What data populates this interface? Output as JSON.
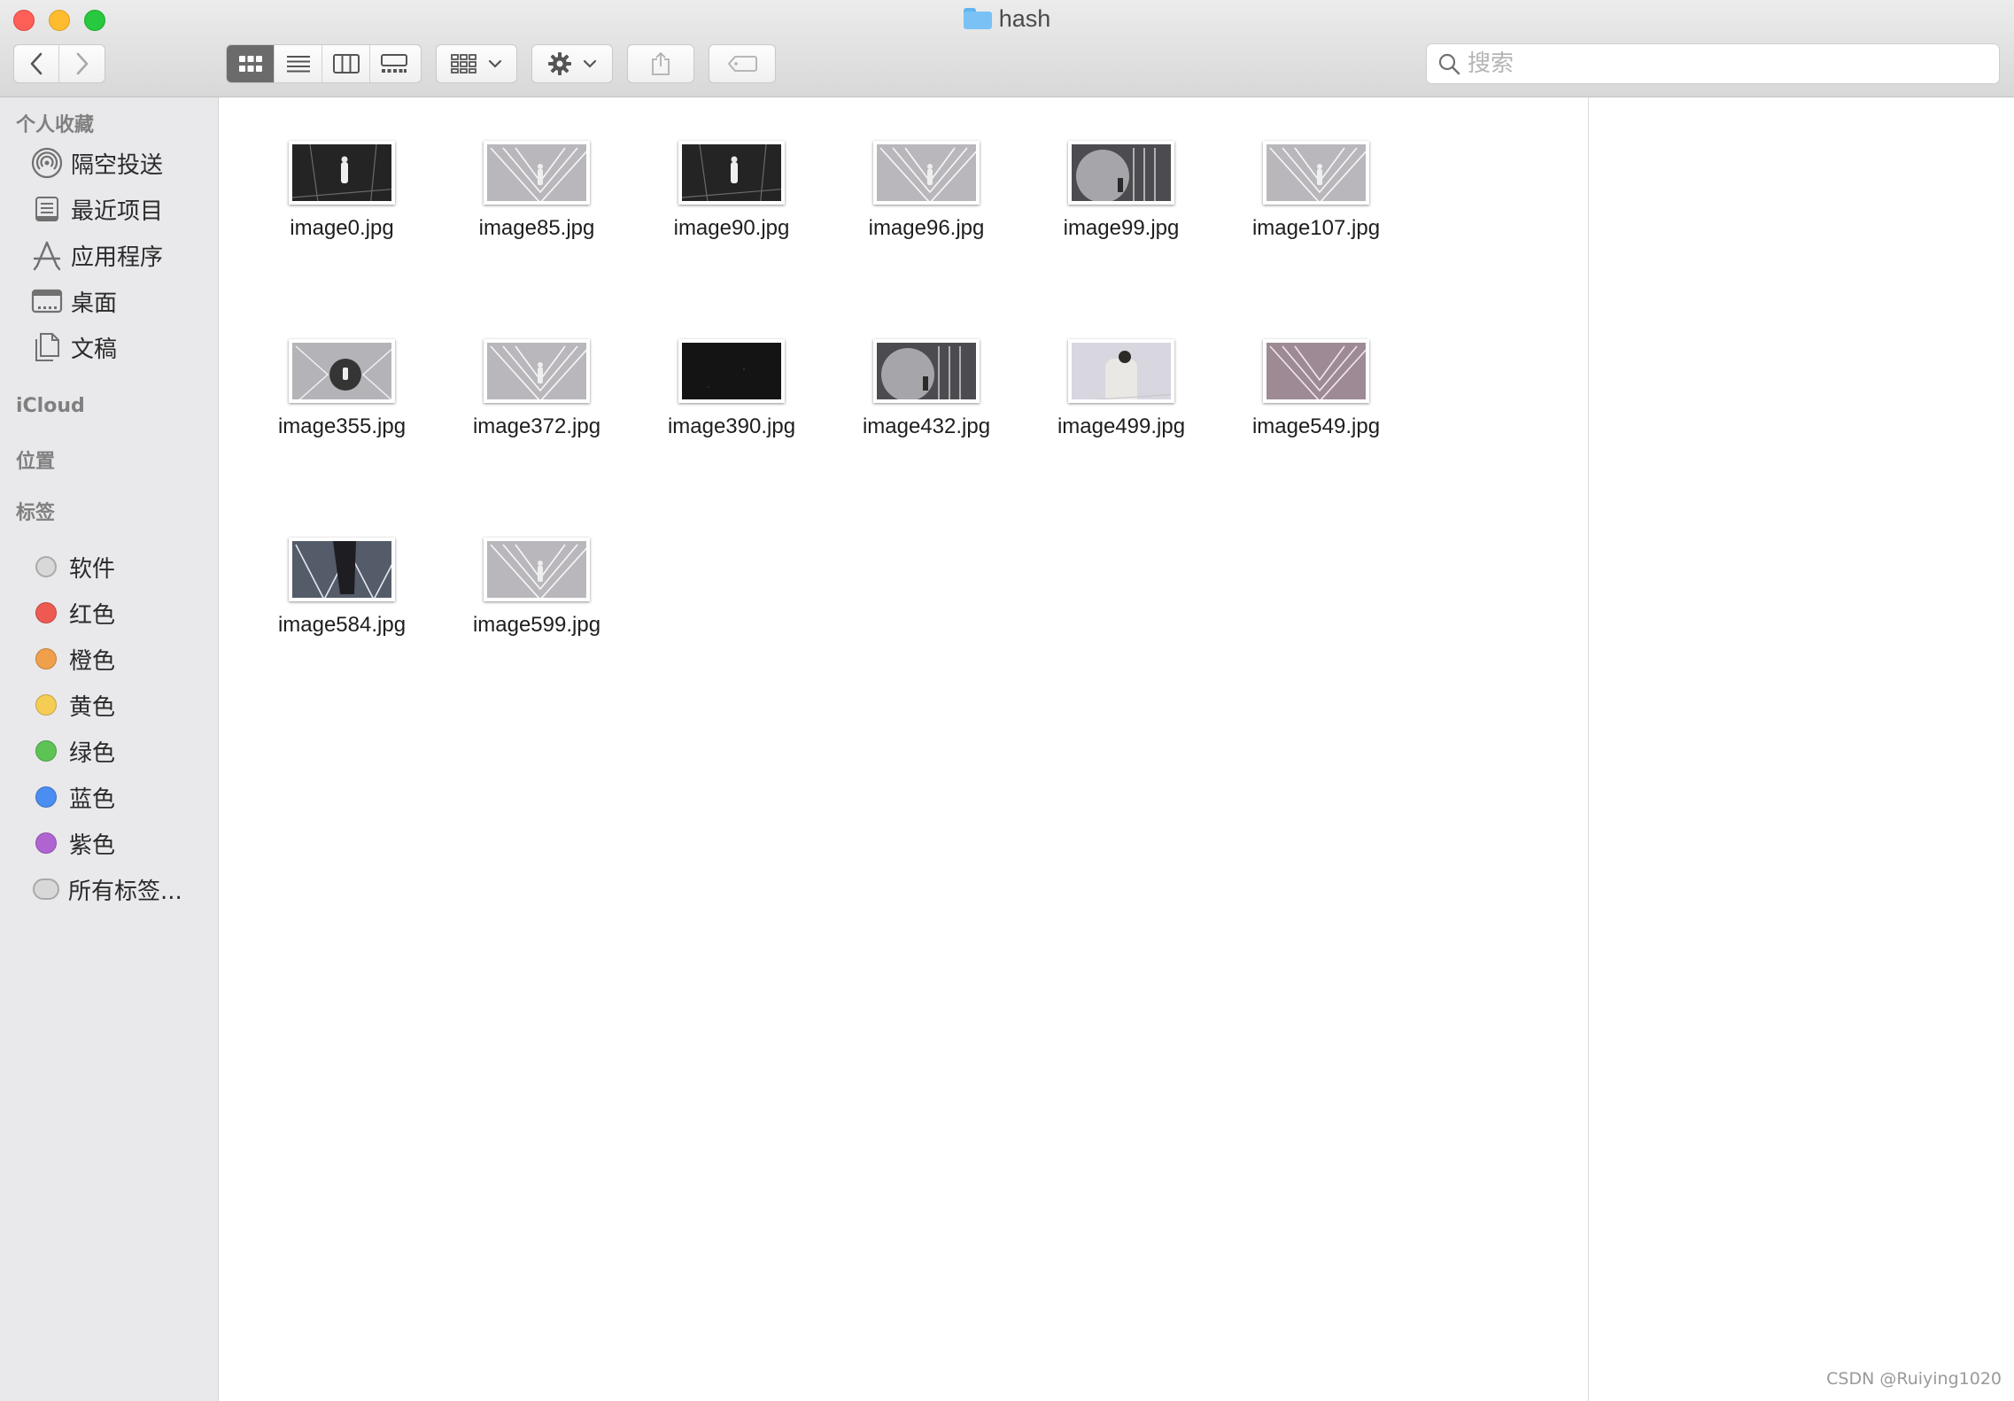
{
  "window": {
    "title": "hash"
  },
  "toolbar": {
    "view_modes": [
      "icon-view",
      "list-view",
      "column-view",
      "gallery-view"
    ],
    "active_view": 0
  },
  "search": {
    "placeholder": "搜索",
    "value": ""
  },
  "sidebar": {
    "favorites_header": "个人收藏",
    "favorites": [
      {
        "label": "隔空投送",
        "icon": "airdrop-icon"
      },
      {
        "label": "最近项目",
        "icon": "recents-icon"
      },
      {
        "label": "应用程序",
        "icon": "applications-icon"
      },
      {
        "label": "桌面",
        "icon": "desktop-icon"
      },
      {
        "label": "文稿",
        "icon": "documents-icon"
      }
    ],
    "icloud_header": "iCloud",
    "locations_header": "位置",
    "tags_header": "标签",
    "tags": [
      {
        "label": "软件",
        "color": "#d8d8d8"
      },
      {
        "label": "红色",
        "color": "#ee5a52"
      },
      {
        "label": "橙色",
        "color": "#f0a04a"
      },
      {
        "label": "黄色",
        "color": "#f5cd55"
      },
      {
        "label": "绿色",
        "color": "#5ec355"
      },
      {
        "label": "蓝色",
        "color": "#4a8ef2"
      },
      {
        "label": "紫色",
        "color": "#b064d2"
      },
      {
        "label": "所有标签...",
        "color": "#d8d8d8"
      }
    ]
  },
  "files": [
    {
      "name": "image0.jpg",
      "tone": "dark"
    },
    {
      "name": "image85.jpg",
      "tone": "light"
    },
    {
      "name": "image90.jpg",
      "tone": "dark"
    },
    {
      "name": "image96.jpg",
      "tone": "light"
    },
    {
      "name": "image99.jpg",
      "tone": "mid"
    },
    {
      "name": "image107.jpg",
      "tone": "light"
    },
    {
      "name": "image355.jpg",
      "tone": "circle"
    },
    {
      "name": "image372.jpg",
      "tone": "light"
    },
    {
      "name": "image390.jpg",
      "tone": "black"
    },
    {
      "name": "image432.jpg",
      "tone": "mid"
    },
    {
      "name": "image499.jpg",
      "tone": "pale"
    },
    {
      "name": "image549.jpg",
      "tone": "pink"
    },
    {
      "name": "image584.jpg",
      "tone": "figure"
    },
    {
      "name": "image599.jpg",
      "tone": "light"
    }
  ],
  "watermark": "CSDN @Ruiying1020"
}
